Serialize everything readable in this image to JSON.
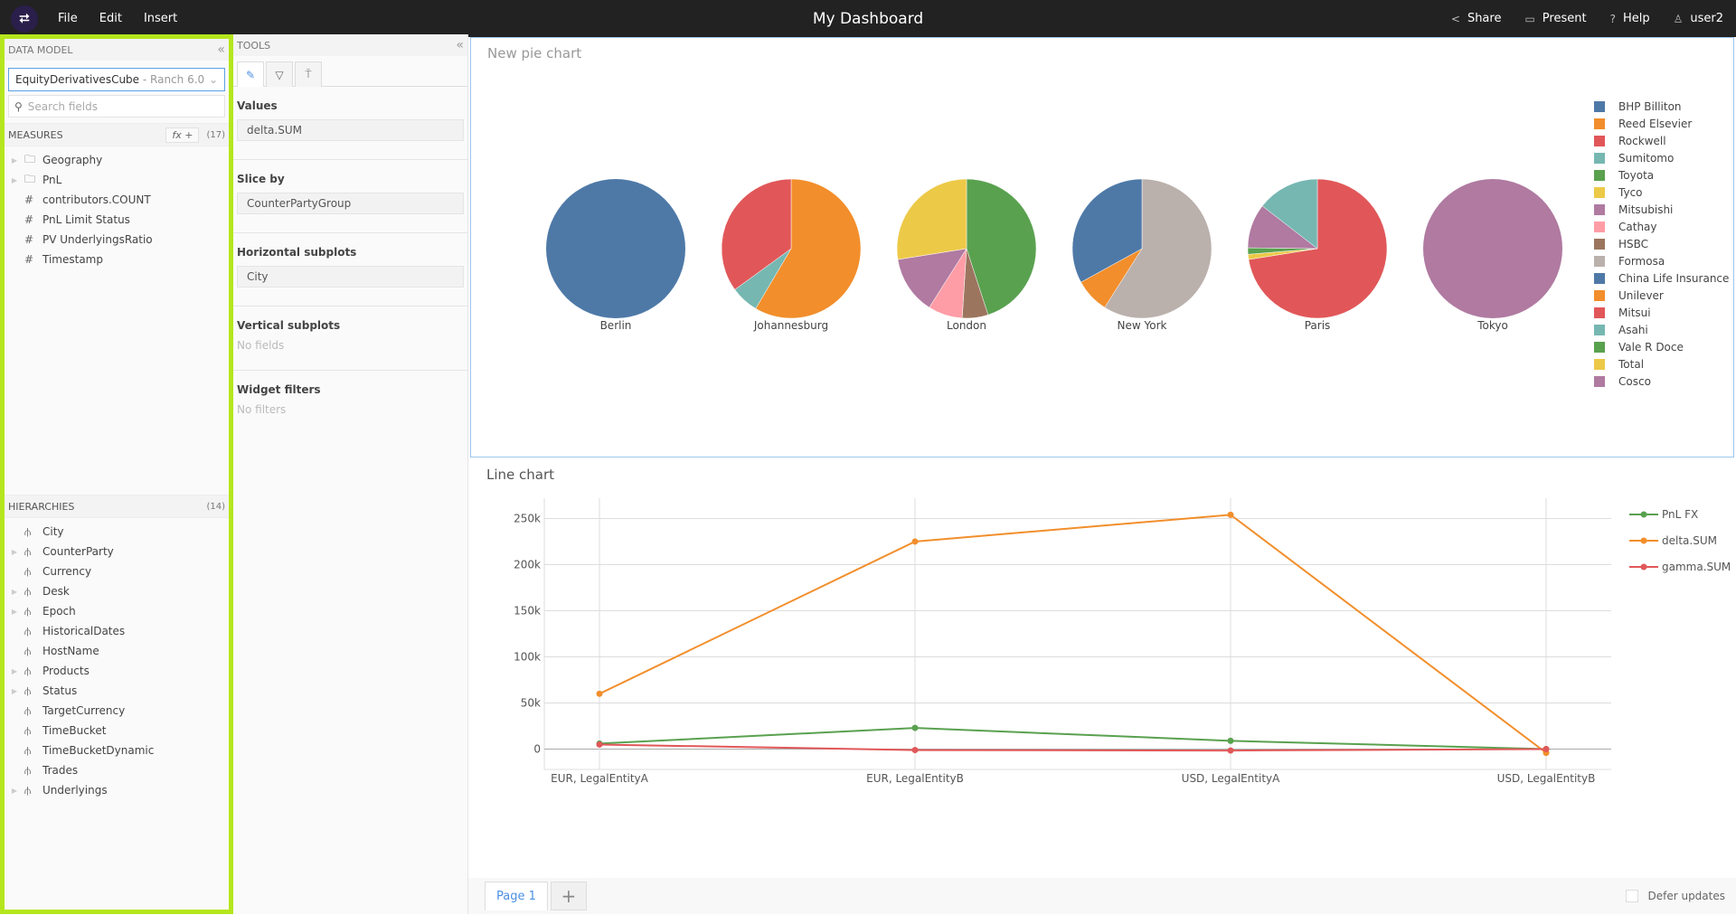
{
  "topbar": {
    "title": "My Dashboard",
    "menu": [
      "File",
      "Edit",
      "Insert"
    ],
    "actions": [
      {
        "icon": "share-icon",
        "label": "Share"
      },
      {
        "icon": "monitor-icon",
        "label": "Present"
      },
      {
        "icon": "help-icon",
        "label": "Help"
      },
      {
        "icon": "user-icon",
        "label": "user2"
      }
    ]
  },
  "data_model": {
    "header": "DATA MODEL",
    "cube": "EquityDerivativesCube",
    "server": " - Ranch 6.0",
    "search_placeholder": "Search fields",
    "measures_label": "MEASURES",
    "fx_label": "fx +",
    "measures_count": "(17)",
    "measures": [
      {
        "type": "folder",
        "label": "Geography",
        "expandable": true
      },
      {
        "type": "folder",
        "label": "PnL",
        "expandable": true
      },
      {
        "type": "measure",
        "label": "contributors.COUNT"
      },
      {
        "type": "measure",
        "label": "PnL Limit Status"
      },
      {
        "type": "measure",
        "label": "PV UnderlyingsRatio"
      },
      {
        "type": "measure",
        "label": "Timestamp"
      }
    ],
    "hierarchies_label": "HIERARCHIES",
    "hierarchies_count": "(14)",
    "hierarchies": [
      {
        "label": "City",
        "expandable": false
      },
      {
        "label": "CounterParty",
        "expandable": true
      },
      {
        "label": "Currency",
        "expandable": false
      },
      {
        "label": "Desk",
        "expandable": true
      },
      {
        "label": "Epoch",
        "expandable": true
      },
      {
        "label": "HistoricalDates",
        "expandable": false
      },
      {
        "label": "HostName",
        "expandable": false
      },
      {
        "label": "Products",
        "expandable": true
      },
      {
        "label": "Status",
        "expandable": true
      },
      {
        "label": "TargetCurrency",
        "expandable": false
      },
      {
        "label": "TimeBucket",
        "expandable": false
      },
      {
        "label": "TimeBucketDynamic",
        "expandable": false
      },
      {
        "label": "Trades",
        "expandable": false
      },
      {
        "label": "Underlyings",
        "expandable": true
      }
    ]
  },
  "tools": {
    "header": "TOOLS",
    "tabs": [
      "pencil-icon",
      "filter-icon",
      "paint-roller-icon"
    ],
    "values_label": "Values",
    "values_field": "delta.SUM",
    "slice_label": "Slice by",
    "slice_field": "CounterPartyGroup",
    "hsub_label": "Horizontal subplots",
    "hsub_field": "City",
    "vsub_label": "Vertical subplots",
    "vsub_empty": "No fields",
    "filters_label": "Widget filters",
    "filters_empty": "No filters"
  },
  "footer": {
    "page_tab": "Page 1",
    "add_label": "+",
    "defer_label": "Defer updates",
    "defer_checked": false
  },
  "chart_data": [
    {
      "type": "pie",
      "title": "New pie chart",
      "legend_position": "right",
      "legend": [
        {
          "name": "BHP Billiton",
          "color": "#4e79a7"
        },
        {
          "name": "Reed Elsevier",
          "color": "#f28e2b"
        },
        {
          "name": "Rockwell",
          "color": "#e15759"
        },
        {
          "name": "Sumitomo",
          "color": "#76b7b2"
        },
        {
          "name": "Toyota",
          "color": "#59a14f"
        },
        {
          "name": "Tyco",
          "color": "#edc948"
        },
        {
          "name": "Mitsubishi",
          "color": "#b07aa1"
        },
        {
          "name": "Cathay",
          "color": "#ff9da7"
        },
        {
          "name": "HSBC",
          "color": "#9c755f"
        },
        {
          "name": "Formosa",
          "color": "#bab0ac"
        },
        {
          "name": "China Life Insurance",
          "color": "#4e79a7"
        },
        {
          "name": "Unilever",
          "color": "#f28e2b"
        },
        {
          "name": "Mitsui",
          "color": "#e15759"
        },
        {
          "name": "Asahi",
          "color": "#76b7b2"
        },
        {
          "name": "Vale R Doce",
          "color": "#59a14f"
        },
        {
          "name": "Total",
          "color": "#edc948"
        },
        {
          "name": "Cosco",
          "color": "#b07aa1"
        }
      ],
      "subplots": [
        {
          "city": "Berlin",
          "slices": [
            {
              "name": "BHP Billiton",
              "color": "#4e79a7",
              "pct": 100
            }
          ]
        },
        {
          "city": "Johannesburg",
          "slices": [
            {
              "name": "Reed Elsevier",
              "color": "#f28e2b",
              "pct": 58.5
            },
            {
              "name": "Sumitomo",
              "color": "#76b7b2",
              "pct": 6.5
            },
            {
              "name": "Rockwell",
              "color": "#e15759",
              "pct": 35
            }
          ]
        },
        {
          "city": "London",
          "slices": [
            {
              "name": "Toyota",
              "color": "#59a14f",
              "pct": 45
            },
            {
              "name": "HSBC",
              "color": "#9c755f",
              "pct": 6
            },
            {
              "name": "Cathay",
              "color": "#ff9da7",
              "pct": 8
            },
            {
              "name": "Mitsubishi",
              "color": "#b07aa1",
              "pct": 13.5
            },
            {
              "name": "Tyco",
              "color": "#edc948",
              "pct": 27.5
            }
          ]
        },
        {
          "city": "New York",
          "slices": [
            {
              "name": "Formosa",
              "color": "#bab0ac",
              "pct": 59
            },
            {
              "name": "Unilever",
              "color": "#f28e2b",
              "pct": 8
            },
            {
              "name": "China Life Insurance",
              "color": "#4e79a7",
              "pct": 33
            }
          ]
        },
        {
          "city": "Paris",
          "slices": [
            {
              "name": "Mitsui",
              "color": "#e15759",
              "pct": 72.5
            },
            {
              "name": "Total",
              "color": "#edc948",
              "pct": 1.2
            },
            {
              "name": "Vale R Doce",
              "color": "#59a14f",
              "pct": 1.5
            },
            {
              "name": "Mitsubishi",
              "color": "#b07aa1",
              "pct": 10.3
            },
            {
              "name": "Asahi",
              "color": "#76b7b2",
              "pct": 14.5
            }
          ]
        },
        {
          "city": "Tokyo",
          "slices": [
            {
              "name": "Cosco",
              "color": "#b07aa1",
              "pct": 100
            }
          ]
        }
      ]
    },
    {
      "type": "line",
      "title": "Line chart",
      "legend_position": "top-right",
      "categories": [
        "EUR, LegalEntityA",
        "EUR, LegalEntityB",
        "USD, LegalEntityA",
        "USD, LegalEntityB"
      ],
      "series": [
        {
          "name": "PnL FX",
          "color": "#59a14f",
          "values": [
            6000,
            23000,
            9000,
            0
          ]
        },
        {
          "name": "delta.SUM",
          "color": "#f28e2b",
          "values": [
            60000,
            225000,
            254000,
            -4000
          ]
        },
        {
          "name": "gamma.SUM",
          "color": "#e15759",
          "values": [
            5000,
            -1000,
            -1500,
            0
          ]
        }
      ],
      "yticks": [
        0,
        50000,
        100000,
        150000,
        200000,
        250000
      ],
      "ytick_labels": [
        "0",
        "50k",
        "100k",
        "150k",
        "200k",
        "250k"
      ],
      "ylim": [
        -22000,
        272000
      ],
      "grid": true,
      "xlabel": "",
      "ylabel": ""
    }
  ]
}
